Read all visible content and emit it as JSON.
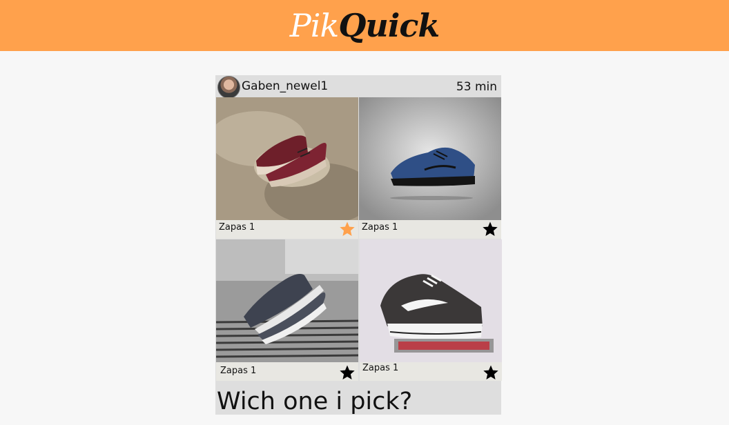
{
  "header": {
    "logo_part1": "Pik",
    "logo_part2": "Quick",
    "logo_color": "#ffa14c"
  },
  "post": {
    "username": "Gaben_newel1",
    "time": "53 min",
    "question": "Wich one i pick?",
    "options": [
      {
        "label": "Zapas 1",
        "starred": true,
        "star_color": "#ffa14c"
      },
      {
        "label": "Zapas 1",
        "starred": false,
        "star_color": "#000000"
      },
      {
        "label": "Zapas 1",
        "starred": false,
        "star_color": "#000000"
      },
      {
        "label": "Zapas 1",
        "starred": false,
        "star_color": "#000000"
      }
    ]
  }
}
